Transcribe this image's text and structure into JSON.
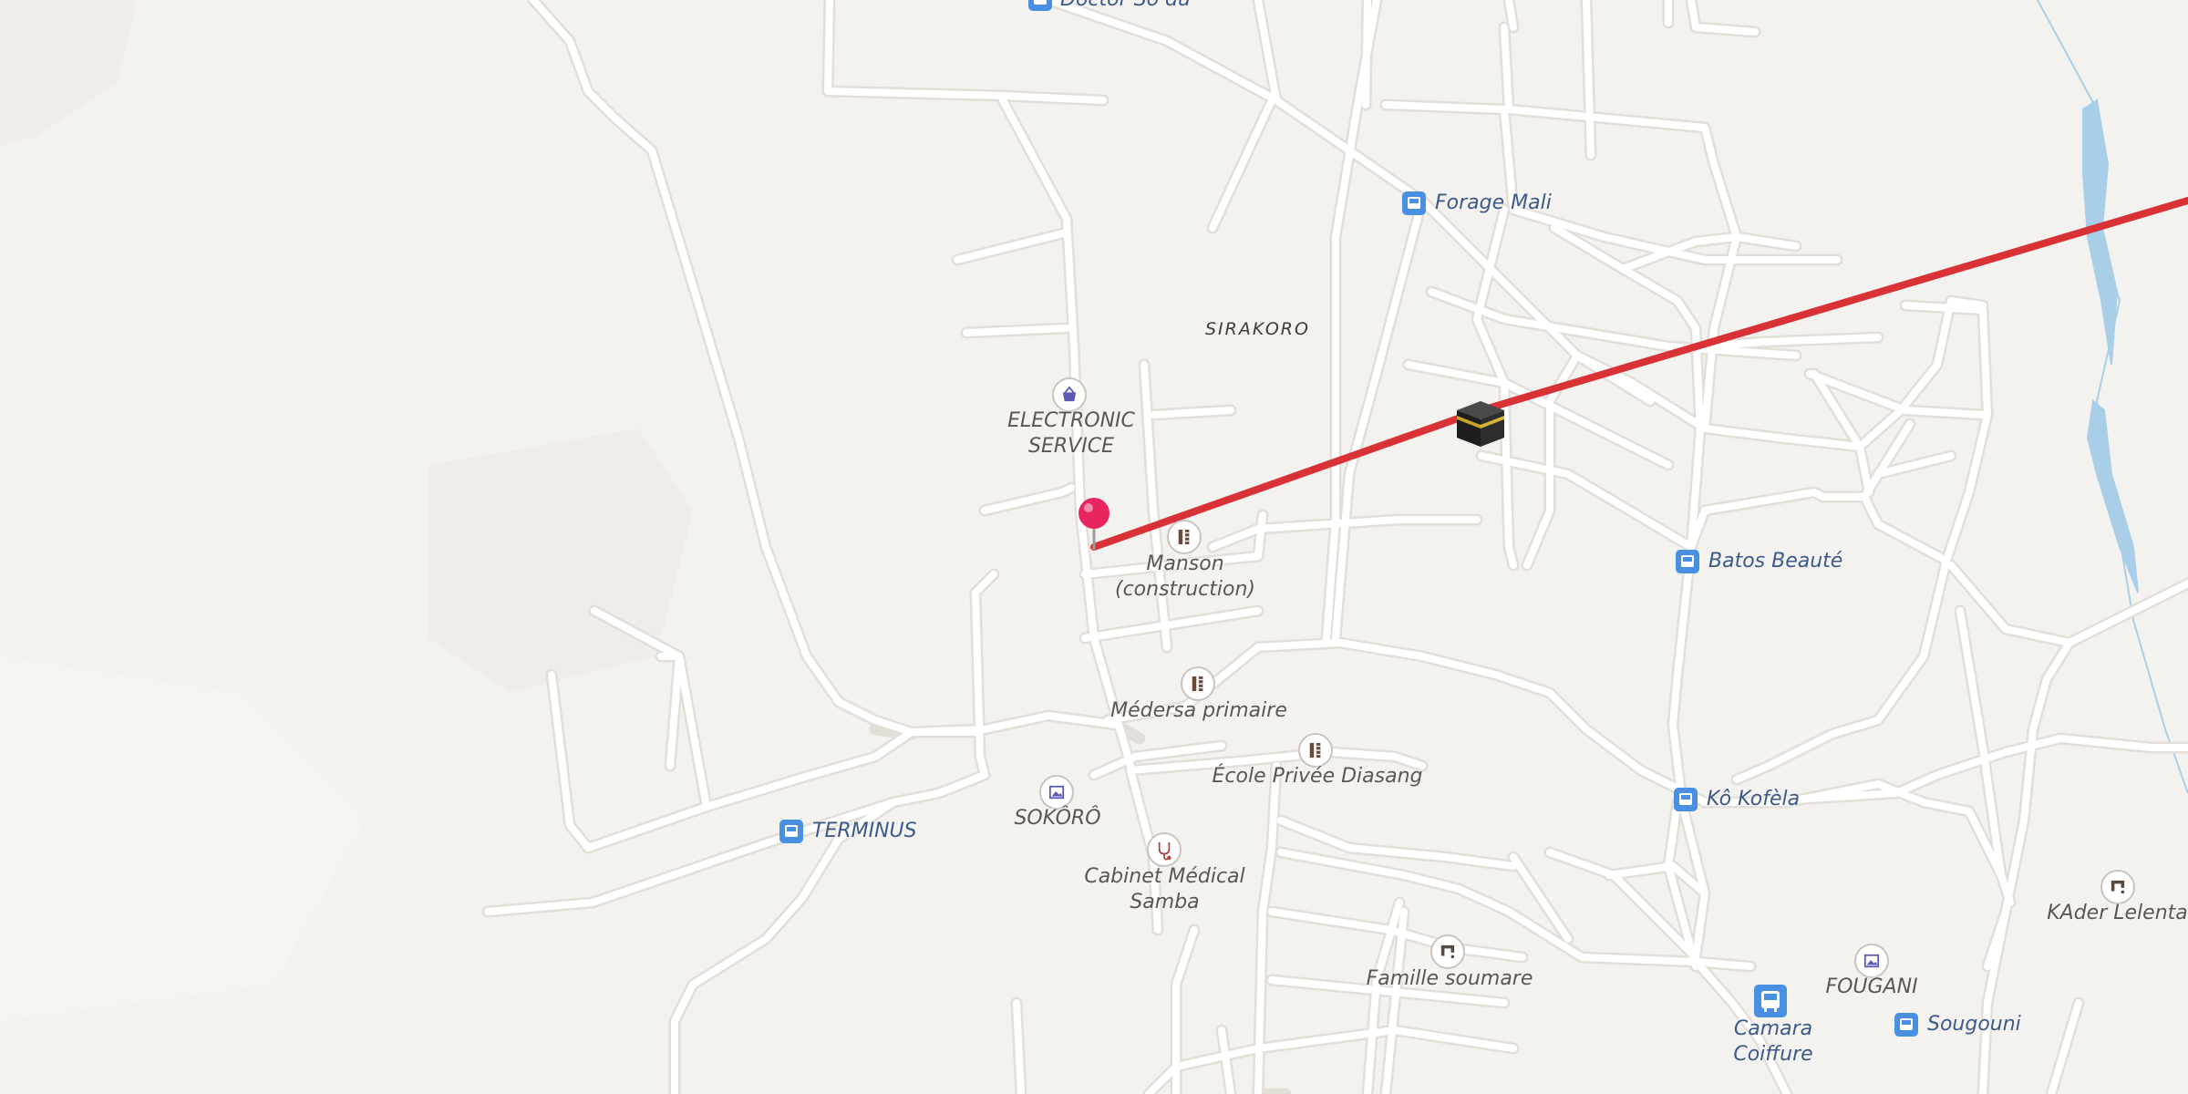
{
  "map": {
    "area_label": "SIRAKORO",
    "route_color": "#d83236",
    "pin_color": "#e8255f",
    "water_color": "#a9cfe8",
    "pois": [
      {
        "id": "doctor",
        "label": "Doctor So du",
        "icon": "bus-stop-icon"
      },
      {
        "id": "forage-mali",
        "label": "Forage Mali",
        "icon": "bus-stop-icon"
      },
      {
        "id": "electronic-service",
        "label": "ELECTRONIC\nSERVICE",
        "icon": "shopping-basket-icon"
      },
      {
        "id": "manson",
        "label": "Manson\n(construction)",
        "icon": "ruler-icon"
      },
      {
        "id": "batos-beaute",
        "label": "Batos Beauté",
        "icon": "bus-stop-icon"
      },
      {
        "id": "medersa",
        "label": "Médersa primaire",
        "icon": "ruler-icon"
      },
      {
        "id": "ecole-privee",
        "label": "École Privée Diasang",
        "icon": "ruler-icon"
      },
      {
        "id": "terminus",
        "label": "TERMINUS",
        "icon": "bus-stop-icon"
      },
      {
        "id": "sokoro",
        "label": "SOKÔRÔ",
        "icon": "picture-frame-icon"
      },
      {
        "id": "ko-kofela",
        "label": "Kô Kofèla",
        "icon": "bus-stop-icon"
      },
      {
        "id": "cabinet-medical",
        "label": "Cabinet Médical\nSamba",
        "icon": "stethoscope-icon"
      },
      {
        "id": "kader-lelenta",
        "label": "KAder Lelenta",
        "icon": "water-tap-icon"
      },
      {
        "id": "fougani",
        "label": "FOUGANI",
        "icon": "picture-frame-icon"
      },
      {
        "id": "famille-soumare",
        "label": "Famille soumare",
        "icon": "water-tap-icon"
      },
      {
        "id": "camara-coiffure",
        "label": "Camara Coiffure",
        "icon": "bus-station-icon"
      },
      {
        "id": "sougouni",
        "label": "Sougouni",
        "icon": "bus-stop-icon"
      }
    ],
    "markers": {
      "kaaba": {
        "icon": "kaaba-icon"
      },
      "pin": {
        "icon": "location-pin-icon"
      }
    }
  }
}
